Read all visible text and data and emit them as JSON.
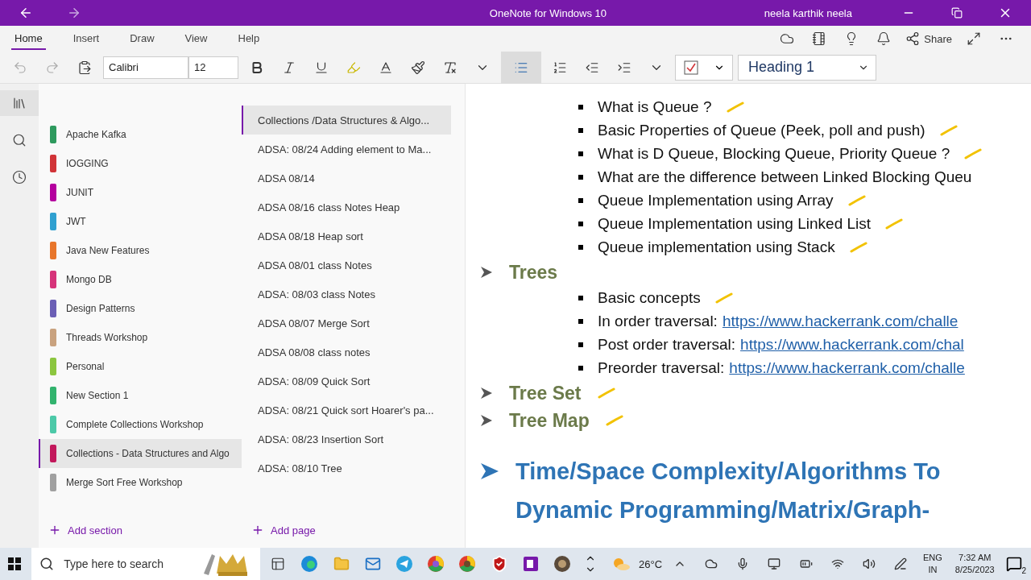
{
  "window": {
    "title": "OneNote for Windows 10",
    "user": "neela karthik neela"
  },
  "ribbon_tabs": [
    {
      "label": "Home",
      "selected": true
    },
    {
      "label": "Insert",
      "selected": false
    },
    {
      "label": "Draw",
      "selected": false
    },
    {
      "label": "View",
      "selected": false
    },
    {
      "label": "Help",
      "selected": false
    }
  ],
  "share_button": "Share",
  "toolbar": {
    "font": "Calibri",
    "size": "12",
    "bullets_selected": true,
    "style": "Heading 1"
  },
  "sections": [
    {
      "name": "Apache Kafka",
      "color": "#2e9a5e",
      "selected": false
    },
    {
      "name": "IOGGING",
      "color": "#d13438",
      "selected": false
    },
    {
      "name": "JUNIT",
      "color": "#b4009e",
      "selected": false
    },
    {
      "name": "JWT",
      "color": "#30a0d0",
      "selected": false
    },
    {
      "name": "Java New Features",
      "color": "#e8762b",
      "selected": false
    },
    {
      "name": "Mongo DB",
      "color": "#d6337a",
      "selected": false
    },
    {
      "name": "Design Patterns",
      "color": "#6b5fb5",
      "selected": false
    },
    {
      "name": "Threads Workshop",
      "color": "#c9a27f",
      "selected": false
    },
    {
      "name": "Personal",
      "color": "#8cc63f",
      "selected": false
    },
    {
      "name": "New Section 1",
      "color": "#32b36e",
      "selected": false
    },
    {
      "name": "Complete Collections Workshop",
      "color": "#4cc9a8",
      "selected": false
    },
    {
      "name": "Collections - Data Structures and Algo",
      "color": "#c2185b",
      "selected": true
    },
    {
      "name": "Merge Sort Free Workshop",
      "color": "#a0a0a0",
      "selected": false
    }
  ],
  "add_section": "Add section",
  "pages": [
    {
      "title": "Collections /Data Structures & Algo...",
      "selected": true
    },
    {
      "title": "ADSA: 08/24 Adding element to Ma...",
      "selected": false
    },
    {
      "title": "ADSA 08/14",
      "selected": false
    },
    {
      "title": "ADSA 08/16 class Notes Heap",
      "selected": false
    },
    {
      "title": "ADSA 08/18 Heap sort",
      "selected": false
    },
    {
      "title": "ADSA 08/01 class Notes",
      "selected": false
    },
    {
      "title": "ADSA: 08/03 class Notes",
      "selected": false
    },
    {
      "title": "ADSA 08/07 Merge Sort",
      "selected": false
    },
    {
      "title": "ADSA 08/08 class notes",
      "selected": false
    },
    {
      "title": "ADSA: 08/09 Quick Sort",
      "selected": false
    },
    {
      "title": "ADSA: 08/21 Quick sort Hoarer's pa...",
      "selected": false
    },
    {
      "title": "ADSA: 08/23 Insertion Sort",
      "selected": false
    },
    {
      "title": "ADSA: 08/10 Tree",
      "selected": false
    }
  ],
  "add_page": "Add page",
  "note": [
    {
      "kind": "bullet",
      "text": "What is Queue ?",
      "marked": true
    },
    {
      "kind": "bullet",
      "text": "Basic Properties of Queue (Peek, poll and push)",
      "marked": true
    },
    {
      "kind": "bullet",
      "text": "What is D Queue, Blocking Queue, Priority Queue ?",
      "marked": true
    },
    {
      "kind": "bullet",
      "text": "What are the difference between Linked Blocking Queu",
      "marked": false
    },
    {
      "kind": "bullet",
      "text": "Queue Implementation using Array",
      "marked": true
    },
    {
      "kind": "bullet",
      "text": "Queue Implementation using Linked List",
      "marked": true
    },
    {
      "kind": "bullet",
      "text": "Queue implementation using Stack",
      "marked": true
    },
    {
      "kind": "heading",
      "text": "Trees",
      "marked": false
    },
    {
      "kind": "bullet",
      "text": "Basic concepts",
      "marked": true
    },
    {
      "kind": "link",
      "text": "In order traversal:",
      "link": "https://www.hackerrank.com/challe",
      "marked": false
    },
    {
      "kind": "link",
      "text": "Post order traversal:",
      "link": "https://www.hackerrank.com/chal",
      "marked": false
    },
    {
      "kind": "link",
      "text": "Preorder traversal:",
      "link": "https://www.hackerrank.com/challe",
      "marked": false
    },
    {
      "kind": "heading",
      "text": "Tree Set",
      "marked": true
    },
    {
      "kind": "heading",
      "text": "Tree Map",
      "marked": true
    },
    {
      "kind": "title",
      "text": "Time/Space Complexity/Algorithms To",
      "marked": false
    },
    {
      "kind": "title_cont",
      "text": "Dynamic Programming/Matrix/Graph-",
      "marked": false
    }
  ],
  "taskbar": {
    "search_placeholder": "Type here to search",
    "temperature": "26°C",
    "language": "ENG",
    "region": "IN",
    "time": "7:32 AM",
    "date": "8/25/2023",
    "notifications": "2"
  }
}
